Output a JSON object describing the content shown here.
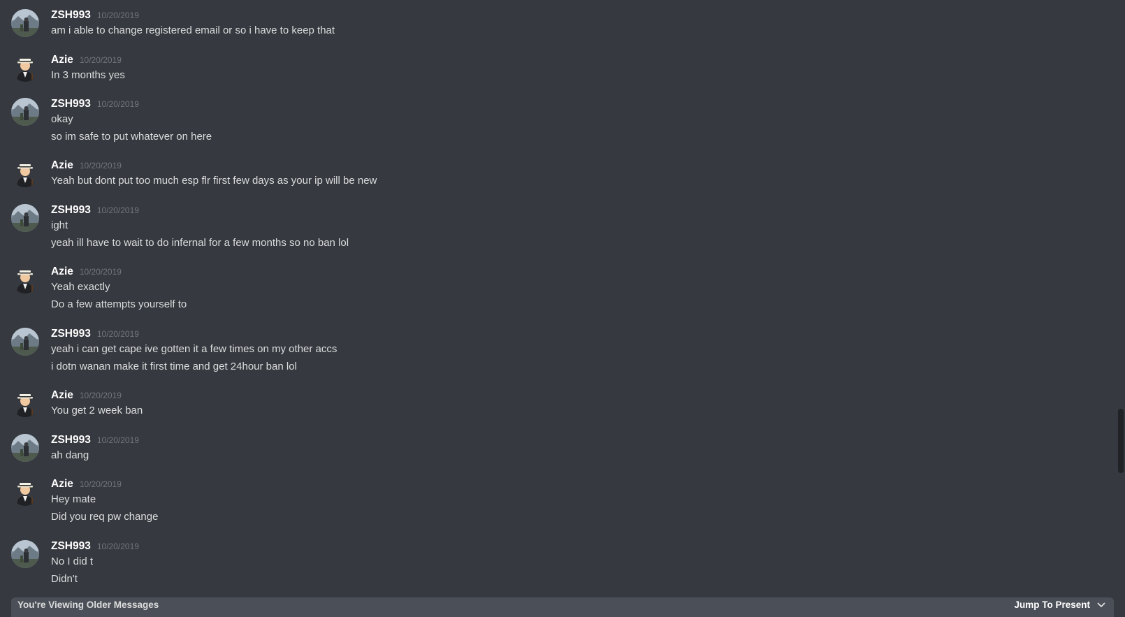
{
  "messages": [
    {
      "author": "ZSH993",
      "avatar": "zsh993-avatar",
      "timestamp": "10/20/2019",
      "lines": [
        "am i able to change registered email or so i have to keep that"
      ]
    },
    {
      "author": "Azie",
      "avatar": "azie-avatar",
      "timestamp": "10/20/2019",
      "lines": [
        "In 3 months yes"
      ]
    },
    {
      "author": "ZSH993",
      "avatar": "zsh993-avatar",
      "timestamp": "10/20/2019",
      "lines": [
        "okay",
        "so im safe to put whatever on here"
      ]
    },
    {
      "author": "Azie",
      "avatar": "azie-avatar",
      "timestamp": "10/20/2019",
      "lines": [
        "Yeah but dont put too much esp flr first few days as your ip will be new"
      ]
    },
    {
      "author": "ZSH993",
      "avatar": "zsh993-avatar",
      "timestamp": "10/20/2019",
      "lines": [
        "ight",
        "yeah ill have to wait to do infernal for a few months so no ban lol"
      ]
    },
    {
      "author": "Azie",
      "avatar": "azie-avatar",
      "timestamp": "10/20/2019",
      "lines": [
        "Yeah exactly",
        "Do a few attempts yourself to"
      ]
    },
    {
      "author": "ZSH993",
      "avatar": "zsh993-avatar",
      "timestamp": "10/20/2019",
      "lines": [
        "yeah i can get cape ive gotten it a few times on my other accs",
        "i dotn wanan make it first time and get 24hour ban lol"
      ]
    },
    {
      "author": "Azie",
      "avatar": "azie-avatar",
      "timestamp": "10/20/2019",
      "lines": [
        "You get 2 week ban"
      ]
    },
    {
      "author": "ZSH993",
      "avatar": "zsh993-avatar",
      "timestamp": "10/20/2019",
      "lines": [
        "ah dang"
      ]
    },
    {
      "author": "Azie",
      "avatar": "azie-avatar",
      "timestamp": "10/20/2019",
      "lines": [
        "Hey mate",
        "Did you req pw change"
      ]
    },
    {
      "author": "ZSH993",
      "avatar": "zsh993-avatar",
      "timestamp": "10/20/2019",
      "lines": [
        "No I did t",
        "Didn't"
      ]
    }
  ],
  "older_bar": {
    "label": "You're Viewing Older Messages",
    "jump_label": "Jump To Present",
    "jump_icon": "chevron-down-icon"
  },
  "colors": {
    "background": "#36393f",
    "username": "#ffffff",
    "timestamp": "#72767d",
    "message_text": "#dcddde",
    "older_bar": "#4b4f57"
  }
}
